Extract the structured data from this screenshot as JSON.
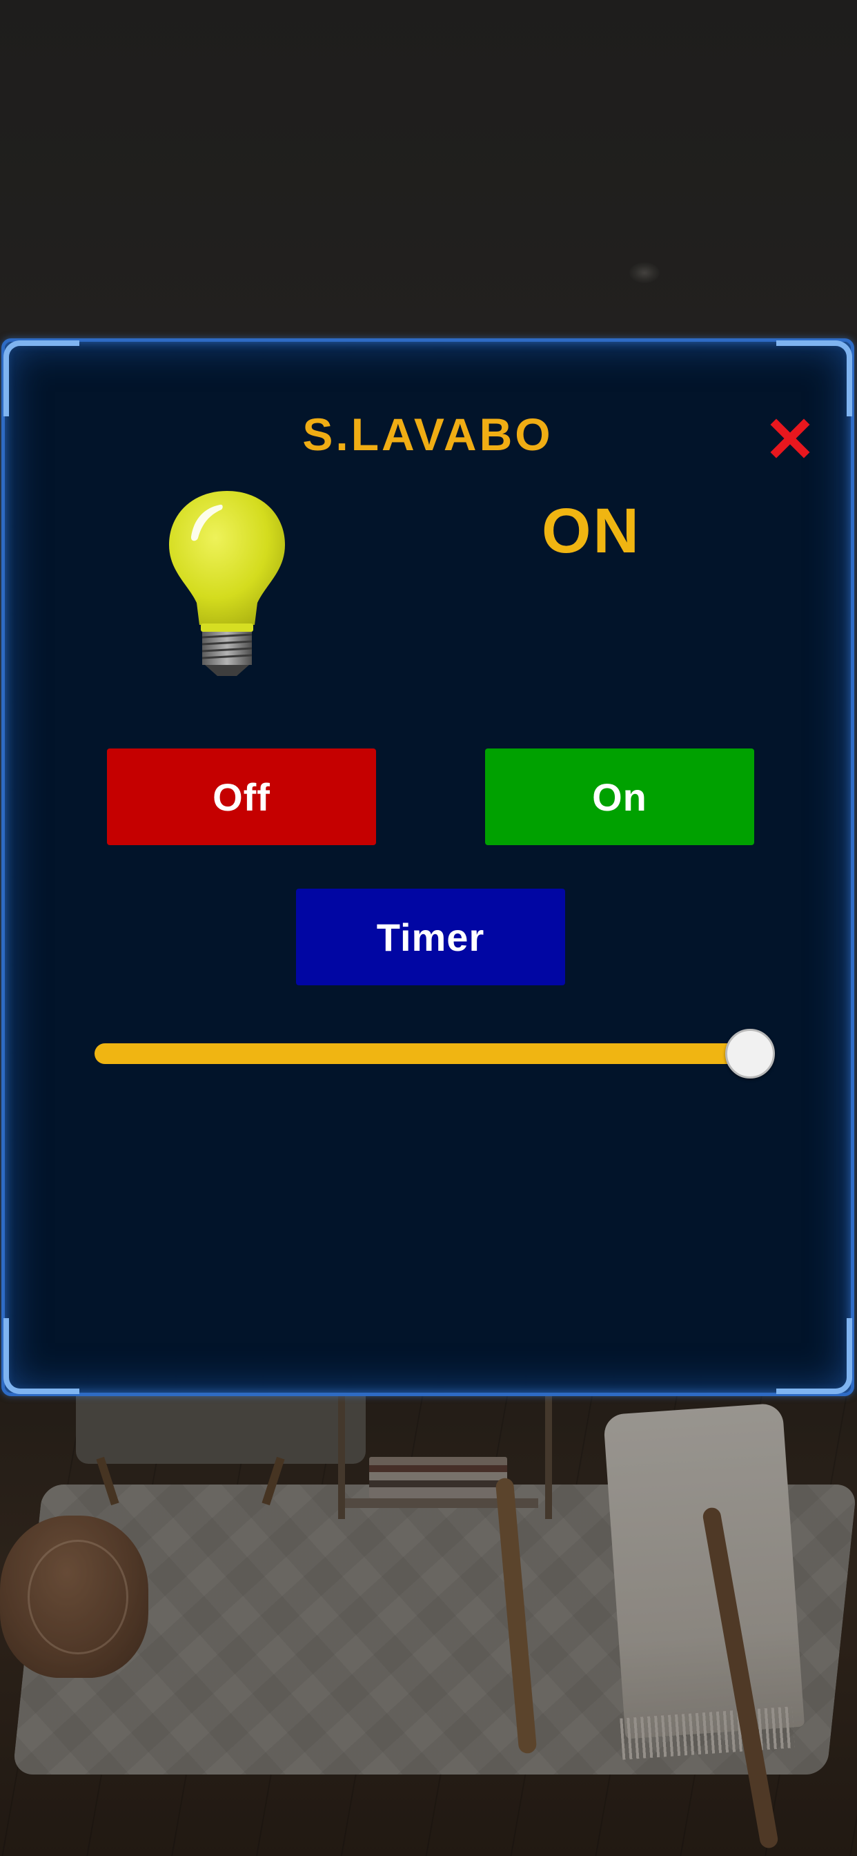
{
  "dialog": {
    "title": "S.LAVABO",
    "state_text": "ON",
    "close_icon": "close-x-icon",
    "bulb_icon": "light-bulb-icon",
    "buttons": {
      "off_label": "Off",
      "on_label": "On",
      "timer_label": "Timer"
    },
    "slider": {
      "value_fraction": 0.96
    }
  },
  "colors": {
    "panel_background": "#02142a",
    "panel_border": "#2e6bc4",
    "accent_yellow": "#f0b512",
    "close_red": "#e8171e",
    "off_button": "#c50000",
    "on_button": "#00a100",
    "timer_button": "#0106a3"
  }
}
